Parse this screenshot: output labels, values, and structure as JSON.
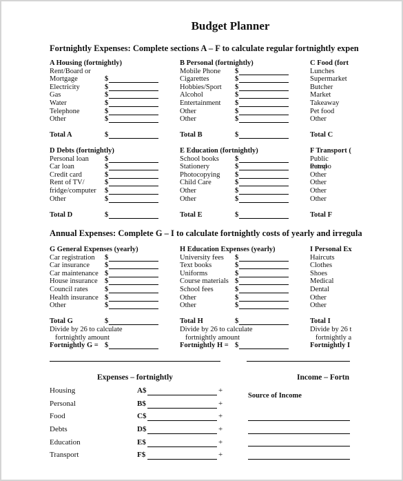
{
  "title": "Budget Planner",
  "fortnightly_heading": "Fortnightly Expenses:  Complete sections A – F to calculate regular fortnightly expen",
  "annual_heading": "Annual Expenses:  Complete G – I to calculate fortnightly costs of yearly and irregula",
  "currency_symbol": "$",
  "sections": {
    "A": {
      "heading": "A  Housing (fortnightly)",
      "pre_label": "Rent/Board or",
      "items": [
        "Mortgage",
        "Electricity",
        "Gas",
        "Water",
        "Telephone",
        "Other"
      ],
      "total_label": "Total A"
    },
    "B": {
      "heading": "B  Personal (fortnightly)",
      "items": [
        "Mobile Phone",
        "Cigarettes",
        "Hobbies/Sport",
        "Alcohol",
        "Entertainment",
        "Other",
        "Other"
      ],
      "total_label": "Total B"
    },
    "C": {
      "heading": "C  Food (fort",
      "items": [
        "Lunches",
        "Supermarket",
        "Butcher",
        "Market",
        "Takeaway",
        "Pet food",
        "Other"
      ],
      "total_label": "Total C"
    },
    "D": {
      "heading": "D  Debts (fortnightly)",
      "items": [
        "Personal loan",
        "Car loan",
        "Credit card",
        "Rent of TV/",
        "fridge/computer",
        "Other"
      ],
      "total_label": "Total D"
    },
    "E": {
      "heading": "E  Education (fortnightly)",
      "items": [
        "School books",
        "Stationery",
        "Photocopying",
        "Child Care",
        "Other",
        "Other"
      ],
      "total_label": "Total E"
    },
    "F": {
      "heading": "F  Transport (",
      "items": [
        "Public transpo",
        "Petrol",
        "Other",
        "Other",
        "Other",
        "Other"
      ],
      "total_label": "Total F"
    },
    "G": {
      "heading": "G  General Expenses (yearly)",
      "items": [
        "Car registration",
        "Car insurance",
        "Car maintenance",
        "House insurance",
        "Council rates",
        "Health insurance",
        "Other"
      ],
      "total_label": "Total G",
      "divide_line1": "Divide by 26 to calculate",
      "divide_line2": "fortnightly amount",
      "fortnightly_label": "Fortnightly G ="
    },
    "H": {
      "heading": "H  Education Expenses (yearly)",
      "items": [
        "University fees",
        "Text books",
        "Uniforms",
        "Course materials",
        "School fees",
        "Other",
        "Other"
      ],
      "total_label": "Total H",
      "divide_line1": "Divide by 26 to calculate",
      "divide_line2": "fortnightly amount",
      "fortnightly_label": "Fortnightly H ="
    },
    "I": {
      "heading": "I  Personal Ex",
      "items": [
        "Haircuts",
        "Clothes",
        "Shoes",
        "Medical",
        "Dental",
        "Other",
        "Other"
      ],
      "total_label": "Total I",
      "divide_line1": "Divide by 26 t",
      "divide_line2": "fortnightly a",
      "fortnightly_label": "Fortnightly I"
    }
  },
  "summary": {
    "expenses_title": "Expenses – fortnightly",
    "rows": [
      {
        "label": "Housing",
        "code": "A$",
        "op": "+"
      },
      {
        "label": "Personal",
        "code": "B$",
        "op": "+"
      },
      {
        "label": "Food",
        "code": "C$",
        "op": "+"
      },
      {
        "label": "Debts",
        "code": "D$",
        "op": "+"
      },
      {
        "label": "Education",
        "code": "E$",
        "op": "+"
      },
      {
        "label": "Transport",
        "code": "F$",
        "op": "+"
      }
    ],
    "income_title": "Income – Fortn",
    "source_label": "Source of Income"
  }
}
